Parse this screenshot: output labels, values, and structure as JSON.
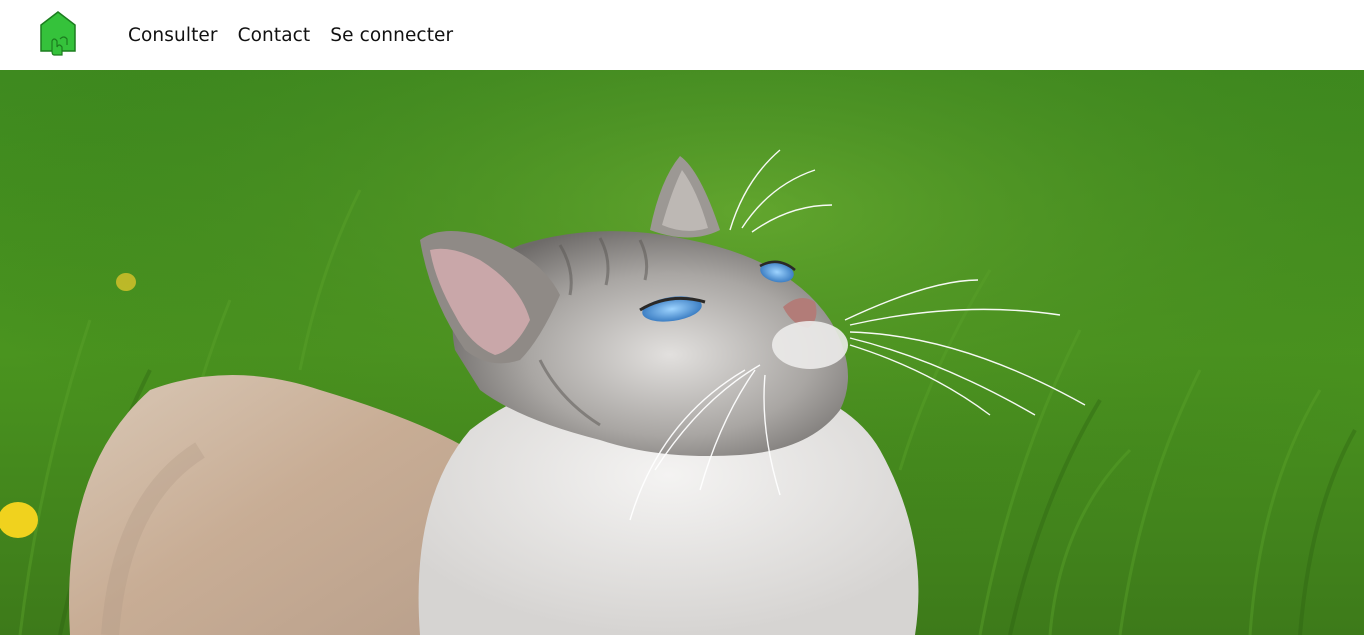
{
  "header": {
    "logo_icon": "house-logo-icon",
    "nav": [
      {
        "label": "Consulter"
      },
      {
        "label": "Contact"
      },
      {
        "label": "Se connecter"
      }
    ]
  },
  "hero": {
    "image_subject": "cat-in-grass-photo"
  },
  "colors": {
    "logo_green": "#2ecc40",
    "logo_outline": "#1a7a1a",
    "grass_dark": "#2f6a14",
    "grass_light": "#6fae2e"
  }
}
